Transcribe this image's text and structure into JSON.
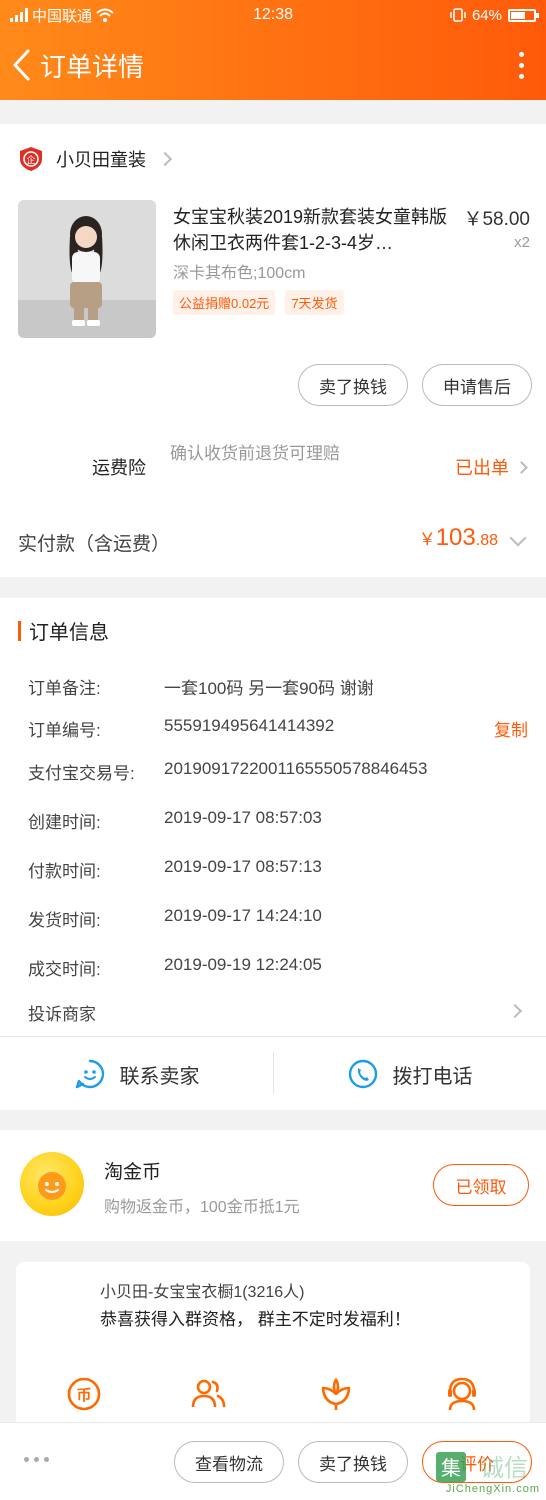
{
  "status_bar": {
    "carrier": "中国联通",
    "time": "12:38",
    "battery": "64%",
    "battery_level": 0.64
  },
  "nav": {
    "title": "订单详情"
  },
  "shop": {
    "name": "小贝田童装"
  },
  "product": {
    "title": "女宝宝秋装2019新款套装女童韩版休闲卫衣两件套1-2-3-4岁…",
    "price": "￥58.00",
    "quantity": "x2",
    "sku": "深卡其布色;100cm",
    "tags": [
      "公益捐赠0.02元",
      "7天发货"
    ],
    "buttons": [
      "卖了换钱",
      "申请售后"
    ]
  },
  "insurance": {
    "label": "运费险",
    "desc": "确认收货前退货可理赔",
    "status": "已出单"
  },
  "payment": {
    "label": "实付款（含运费）",
    "currency": "￥",
    "amount_int": "103",
    "amount_dec": ".88"
  },
  "order_info": {
    "title": "订单信息",
    "rows": [
      {
        "label": "订单备注:",
        "value": "一套100码 另一套90码 谢谢"
      },
      {
        "label": "订单编号:",
        "value": "555919495641414392"
      },
      {
        "label": "支付宝交易号:",
        "value": "2019091722001165550578846453"
      },
      {
        "label": "创建时间:",
        "value": "2019-09-17 08:57:03"
      },
      {
        "label": "付款时间:",
        "value": "2019-09-17 08:57:13"
      },
      {
        "label": "发货时间:",
        "value": "2019-09-17 14:24:10"
      },
      {
        "label": "成交时间:",
        "value": "2019-09-19 12:24:05"
      }
    ],
    "copy_label": "复制",
    "complain_label": "投诉商家",
    "contact_seller": "联系卖家",
    "call_phone": "拨打电话"
  },
  "coins": {
    "title": "淘金币",
    "desc": "购物返金币，100金币抵1元",
    "button": "已领取"
  },
  "group": {
    "name": "小贝田-女宝宝衣橱1(3216人)",
    "message": "恭喜获得入群资格， 群主不定时发福利！",
    "icons": [
      "coin-icon",
      "people-icon",
      "flower-icon",
      "service-icon"
    ]
  },
  "bottom_bar": {
    "buttons": [
      "查看物流",
      "卖了换钱",
      "评价"
    ]
  },
  "watermark": {
    "text": "JiChengXin.com"
  },
  "colors": {
    "accent": "#ff5a0a",
    "header_start": "#ff8a1a",
    "header_end": "#ff5a0a"
  }
}
